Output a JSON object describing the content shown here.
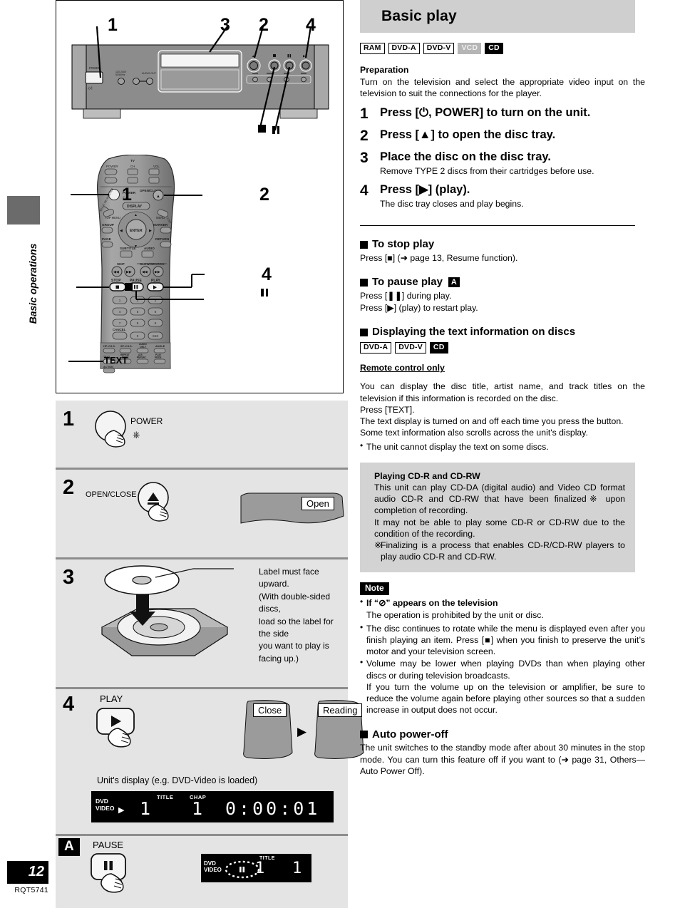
{
  "sidebar": {
    "section_label": "Basic operations",
    "page_number": "12",
    "doc_code": "RQT5741"
  },
  "header": {
    "title": "Basic play"
  },
  "disc_badges": [
    {
      "label": "RAM",
      "style": "outline"
    },
    {
      "label": "DVD-A",
      "style": "outline"
    },
    {
      "label": "DVD-V",
      "style": "outline"
    },
    {
      "label": "VCD",
      "style": "gray"
    },
    {
      "label": "CD",
      "style": "black"
    }
  ],
  "preparation": {
    "heading": "Preparation",
    "text": "Turn on the television and select the appropriate video input on the television to suit the connections for the player."
  },
  "steps": [
    {
      "num": "1",
      "title": "Press [⏻, POWER] to turn on the unit.",
      "sub": ""
    },
    {
      "num": "2",
      "title": "Press [▲] to open the disc tray.",
      "sub": ""
    },
    {
      "num": "3",
      "title": "Place the disc on the disc tray.",
      "sub": "Remove TYPE 2 discs from their cartridges before use."
    },
    {
      "num": "4",
      "title": "Press [▶] (play).",
      "sub": "The disc tray closes and play begins."
    }
  ],
  "stop_play": {
    "heading": "To stop play",
    "text": "Press [■] (➜ page 13, Resume function)."
  },
  "pause_play": {
    "heading": "To pause play",
    "badge": "A",
    "line1": "Press [❚❚] during play.",
    "line2": "Press [▶] (play) to restart play."
  },
  "text_info": {
    "heading": "Displaying the text information on discs",
    "badges": [
      {
        "label": "DVD-A",
        "style": "outline"
      },
      {
        "label": "DVD-V",
        "style": "outline"
      },
      {
        "label": "CD",
        "style": "black"
      }
    ],
    "remote_only": "Remote control only",
    "para": "You can display the disc title, artist name, and track titles on the television if this information is recorded on the disc.",
    "line_press": "Press [TEXT].",
    "line_toggle": "The text display is turned on and off each time you press the button.",
    "line_scroll": "Some text information also scrolls across the unit's display.",
    "bullet": "The unit cannot display the text on some discs."
  },
  "cdrw_box": {
    "heading": "Playing CD-R and CD-RW",
    "para1": "This unit can play CD-DA (digital audio) and Video CD format audio CD-R and CD-RW that have been finalized※ upon completion of recording.",
    "para2": "It may not be able to play some CD-R or CD-RW due to the condition of the recording.",
    "footnote_mark": "※",
    "footnote": "Finalizing is a process that enables CD-R/CD-RW players to play audio CD-R and CD-RW."
  },
  "note": {
    "badge": "Note",
    "bullet1_bold": "If “⊘” appears on the television",
    "bullet1_sub": "The operation is prohibited by the unit or disc.",
    "bullet2": "The disc continues to rotate while the menu is displayed even after you finish playing an item. Press [■] when you finish to preserve the unit’s motor and your television screen.",
    "bullet3": "Volume may be lower when playing DVDs than when playing other discs or during television broadcasts.",
    "bullet3_sub": "If you turn the volume up on the television or amplifier, be sure to reduce the volume again before playing other sources so that a sudden increase in output does not occur."
  },
  "auto_power_off": {
    "heading": "Auto power-off",
    "text": "The unit switches to the standby mode after about 30 minutes in the stop mode. You can turn this feature off if you want to (➜ page 31, Others—Auto Power Off)."
  },
  "front_panel_figure": {
    "callouts": [
      "1",
      "3",
      "2",
      "4"
    ],
    "power_label": "POWER",
    "voltage_label": "120V 60Hz",
    "open_close_label": "OPEN/CLOSE",
    "stop_symbol": "■",
    "pause_symbol": "❚❚"
  },
  "remote_figure": {
    "callout_1": "1",
    "callout_2": "2",
    "callout_4": "4",
    "stop_symbol": "■",
    "pause_symbol": "❚❚",
    "text_label": "TEXT",
    "tv_label": "TV",
    "power_tv": "POWER",
    "tvvcr": "TV/VCR",
    "ch": "CH",
    "vol": "VOL",
    "power": "POWER",
    "open_close": "OPEN/CLOSE",
    "display": "DISPLAY",
    "top_menu": "TOP MENU",
    "menu": "MENU",
    "multi": "MULTI RE-MASTER",
    "play_list": "PLAY LIST",
    "group": "GROUP",
    "marker": "MARKER",
    "page": "PAGE",
    "return": "RETURN",
    "subtitle": "SUBTITLE",
    "audio": "AUDIO",
    "enter": "ENTER",
    "skip": "SKIP",
    "slow_search": "SLOW/SEARCH",
    "stop": "STOP",
    "pause": "PAUSE",
    "play": "PLAY",
    "cancel": "CANCEL",
    "s10": "S10",
    "hp_vss": "HP-V.S.S.",
    "sp_vss": "SP-V.S.S.",
    "audio_only": "AUDIO ONLY",
    "angle": "ANGLE",
    "repeat_mode": "REPEAT MODE",
    "ab_repeat": "A-B REPEAT",
    "play_mode": "PLAY MODE",
    "action": "ACTION",
    "keys": [
      "1",
      "2",
      "3",
      "4",
      "5",
      "6",
      "7",
      "8",
      "9",
      "0"
    ]
  },
  "illustrated_steps": [
    {
      "num": "1",
      "button_label": "POWER",
      "power_symbol": "⏻",
      "caption": ""
    },
    {
      "num": "2",
      "button_label": "OPEN/CLOSE",
      "display_text": "Open"
    },
    {
      "num": "3",
      "caption": "Label must face upward.\n(With double-sided discs,\nload so the label for the side\nyou want to play is facing up.)"
    },
    {
      "num": "4",
      "button_label": "PLAY",
      "display_close": "Close",
      "display_reading": "Reading",
      "unit_display_caption": "Unit's display (e.g. DVD-Video is loaded)"
    }
  ],
  "unit_display": {
    "disc_type_line1": "DVD",
    "disc_type_line2": "VIDEO",
    "play_symbol": "▶",
    "title_label": "TITLE",
    "chap_label": "CHAP",
    "title_value": "1",
    "chap_value": "1",
    "time_value": "0:00:01"
  },
  "pause_panel": {
    "badge": "A",
    "button_label": "PAUSE",
    "pause_symbol": "❚❚",
    "display": {
      "disc_type_line1": "DVD",
      "disc_type_line2": "VIDEO",
      "title_label": "TITLE",
      "title_value": "1",
      "chap_value": "1"
    }
  }
}
